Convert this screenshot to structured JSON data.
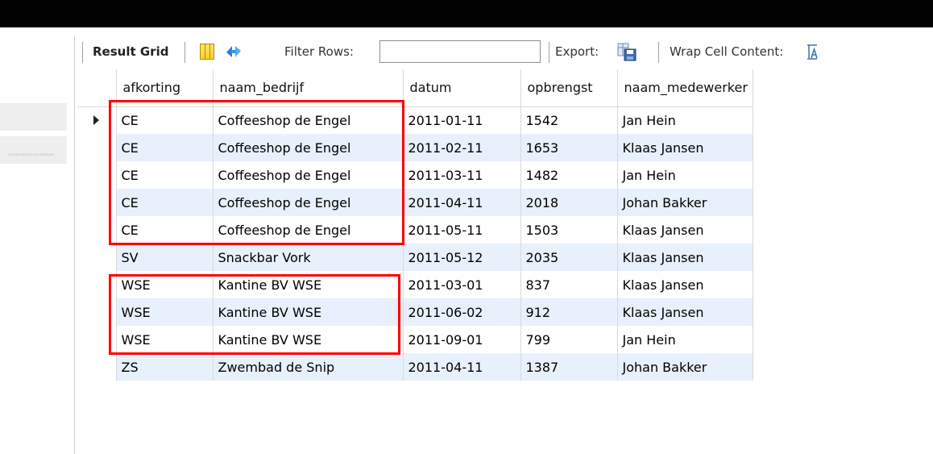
{
  "toolbar": {
    "result_grid": "Result Grid",
    "filter_rows": "Filter Rows:",
    "filter_value": "",
    "export": "Export:",
    "wrap": "Wrap Cell Content:",
    "icons": [
      "grid-toggle-icon",
      "refresh-icon",
      "export-icon",
      "wrap-cell-icon"
    ]
  },
  "table": {
    "headers": [
      "afkorting",
      "naam_bedrijf",
      "datum",
      "opbrengst",
      "naam_medewerker"
    ],
    "rows": [
      [
        "CE",
        "Coffeeshop de Engel",
        "2011-01-11",
        "1542",
        "Jan Hein"
      ],
      [
        "CE",
        "Coffeeshop de Engel",
        "2011-02-11",
        "1653",
        "Klaas Jansen"
      ],
      [
        "CE",
        "Coffeeshop de Engel",
        "2011-03-11",
        "1482",
        "Jan Hein"
      ],
      [
        "CE",
        "Coffeeshop de Engel",
        "2011-04-11",
        "2018",
        "Johan Bakker"
      ],
      [
        "CE",
        "Coffeeshop de Engel",
        "2011-05-11",
        "1503",
        "Klaas Jansen"
      ],
      [
        "SV",
        "Snackbar Vork",
        "2011-05-12",
        "2035",
        "Klaas Jansen"
      ],
      [
        "WSE",
        "Kantine BV WSE",
        "2011-03-01",
        "837",
        "Klaas Jansen"
      ],
      [
        "WSE",
        "Kantine BV WSE",
        "2011-06-02",
        "912",
        "Klaas Jansen"
      ],
      [
        "WSE",
        "Kantine BV WSE",
        "2011-09-01",
        "799",
        "Jan Hein"
      ],
      [
        "ZS",
        "Zwembad de Snip",
        "2011-04-11",
        "1387",
        "Johan Bakker"
      ]
    ],
    "current_row": 0
  },
  "colors": {
    "highlight": "#ff0000",
    "alt_row": "#e8f0fb",
    "topbar": "#000000"
  }
}
